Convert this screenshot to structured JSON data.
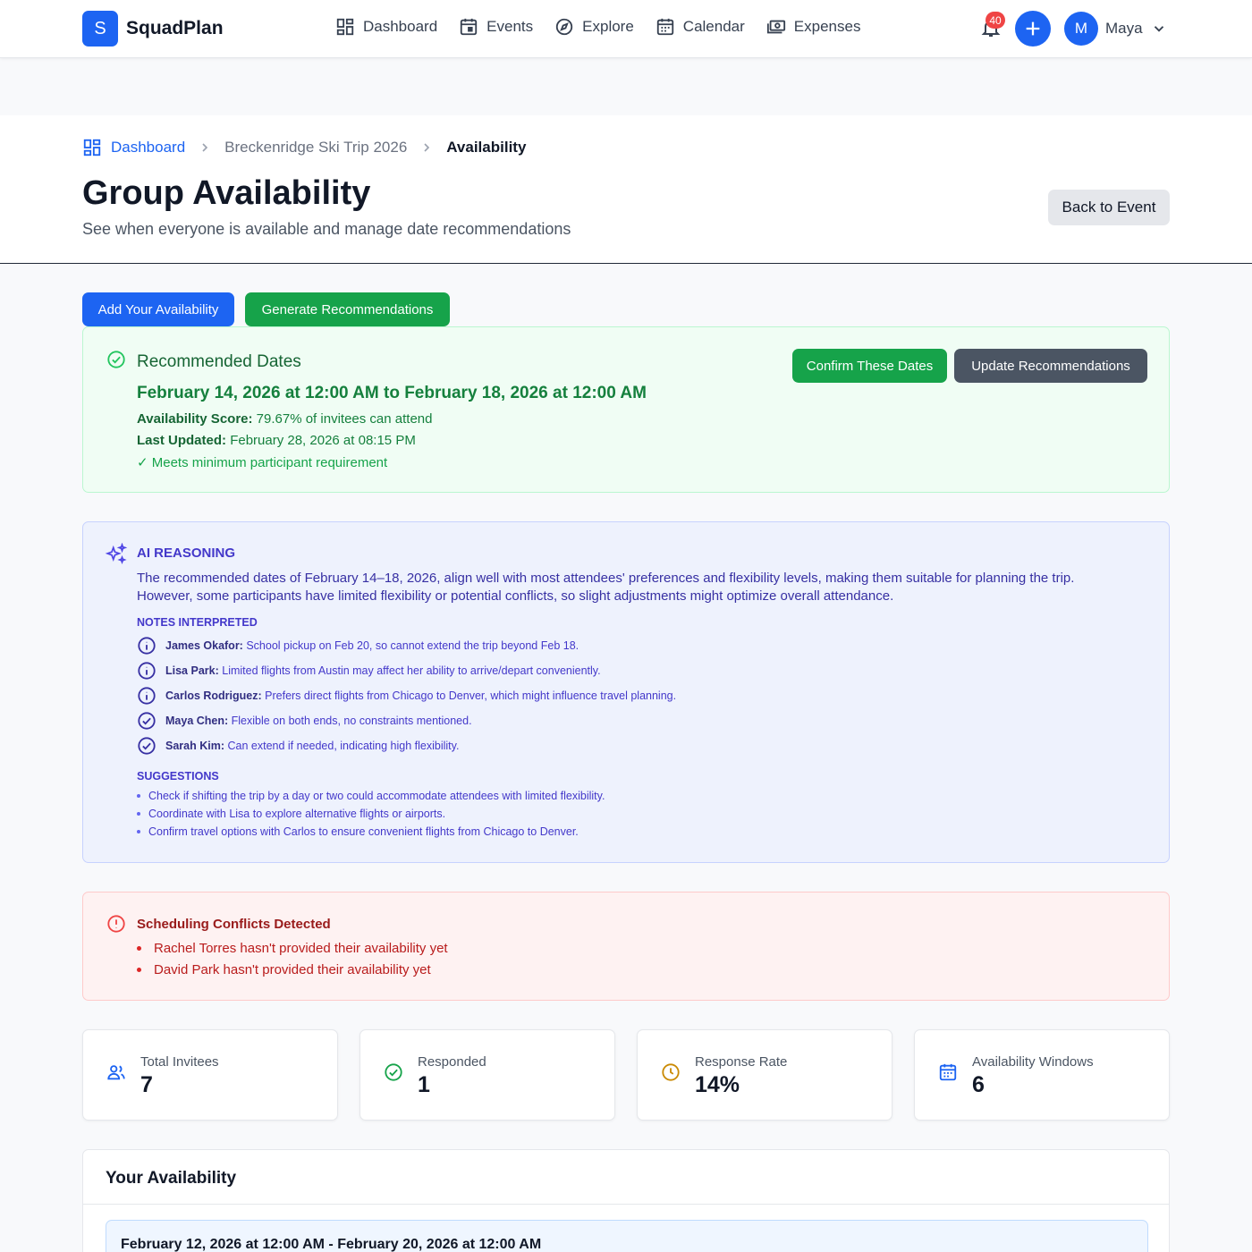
{
  "app": {
    "name": "SquadPlan",
    "logo_letter": "S"
  },
  "nav": {
    "items": [
      {
        "label": "Dashboard",
        "icon": "grid-icon"
      },
      {
        "label": "Events",
        "icon": "calendar-event-icon"
      },
      {
        "label": "Explore",
        "icon": "compass-icon"
      },
      {
        "label": "Calendar",
        "icon": "calendar-icon"
      },
      {
        "label": "Expenses",
        "icon": "money-icon"
      }
    ],
    "notification_count": "40",
    "user_initial": "M",
    "user_name": "Maya"
  },
  "breadcrumb": {
    "home": "Dashboard",
    "event": "Breckenridge Ski Trip 2026",
    "current": "Availability"
  },
  "header": {
    "title": "Group Availability",
    "subtitle": "See when everyone is available and manage date recommendations",
    "back_label": "Back to Event"
  },
  "actions": {
    "add_label": "Add Your Availability",
    "generate_label": "Generate Recommendations"
  },
  "recommended": {
    "title": "Recommended Dates",
    "range": "February 14, 2026 at 12:00 AM to February 18, 2026 at 12:00 AM",
    "score_label": "Availability Score:",
    "score_value": "79.67% of invitees can attend",
    "updated_label": "Last Updated:",
    "updated_value": "February 28, 2026 at 08:15 PM",
    "requirement": "✓ Meets minimum participant requirement",
    "confirm_label": "Confirm These Dates",
    "update_label": "Update Recommendations"
  },
  "ai": {
    "title": "AI REASONING",
    "body": "The recommended dates of February 14–18, 2026, align well with most attendees' preferences and flexibility levels, making them suitable for planning the trip. However, some participants have limited flexibility or potential conflicts, so slight adjustments might optimize overall attendance.",
    "notes_title": "NOTES INTERPRETED",
    "notes": [
      {
        "name": "James Okafor:",
        "text": "School pickup on Feb 20, so cannot extend the trip beyond Feb 18.",
        "icon": "info-circle-icon"
      },
      {
        "name": "Lisa Park:",
        "text": "Limited flights from Austin may affect her ability to arrive/depart conveniently.",
        "icon": "info-circle-icon"
      },
      {
        "name": "Carlos Rodriguez:",
        "text": "Prefers direct flights from Chicago to Denver, which might influence travel planning.",
        "icon": "info-circle-icon"
      },
      {
        "name": "Maya Chen:",
        "text": "Flexible on both ends, no constraints mentioned.",
        "icon": "check-circle-icon"
      },
      {
        "name": "Sarah Kim:",
        "text": "Can extend if needed, indicating high flexibility.",
        "icon": "check-circle-icon"
      }
    ],
    "suggestions_title": "SUGGESTIONS",
    "suggestions": [
      "Check if shifting the trip by a day or two could accommodate attendees with limited flexibility.",
      "Coordinate with Lisa to explore alternative flights or airports.",
      "Confirm travel options with Carlos to ensure convenient flights from Chicago to Denver."
    ]
  },
  "conflicts": {
    "title": "Scheduling Conflicts Detected",
    "items": [
      "Rachel Torres hasn't provided their availability yet",
      "David Park hasn't provided their availability yet"
    ]
  },
  "stats": [
    {
      "label": "Total Invitees",
      "value": "7",
      "icon": "users-icon"
    },
    {
      "label": "Responded",
      "value": "1",
      "icon": "check-circle-icon"
    },
    {
      "label": "Response Rate",
      "value": "14%",
      "icon": "clock-icon"
    },
    {
      "label": "Availability Windows",
      "value": "6",
      "icon": "calendar-icon"
    }
  ],
  "your_availability": {
    "title": "Your Availability",
    "range": "February 12, 2026 at 12:00 AM - February 20, 2026 at 12:00 AM"
  },
  "colors": {
    "primary": "#1d64f2",
    "success": "#16a34a",
    "danger": "#dc2626",
    "indigo": "#4338ca"
  }
}
